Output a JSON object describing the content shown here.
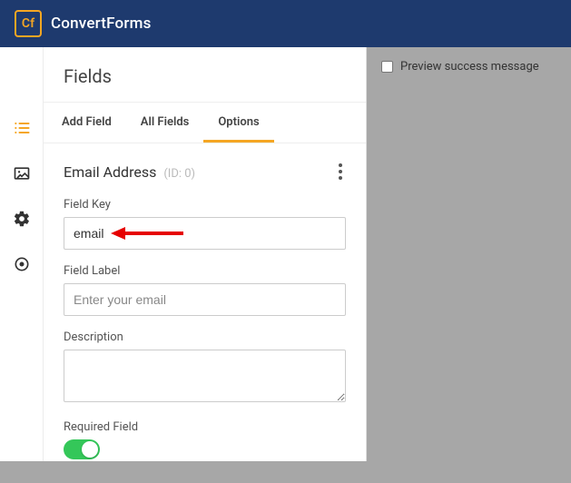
{
  "brand": "ConvertForms",
  "logo_text": "Cf",
  "panel": {
    "title": "Fields"
  },
  "tabs": {
    "add": "Add Field",
    "all": "All Fields",
    "options": "Options"
  },
  "section": {
    "title": "Email Address",
    "id_hint": "(ID: 0)",
    "field_key_label": "Field Key",
    "field_key_value": "email",
    "field_label_label": "Field Label",
    "field_label_placeholder": "Enter your email",
    "description_label": "Description",
    "required_label": "Required Field"
  },
  "right": {
    "preview_label": "Preview success message"
  }
}
